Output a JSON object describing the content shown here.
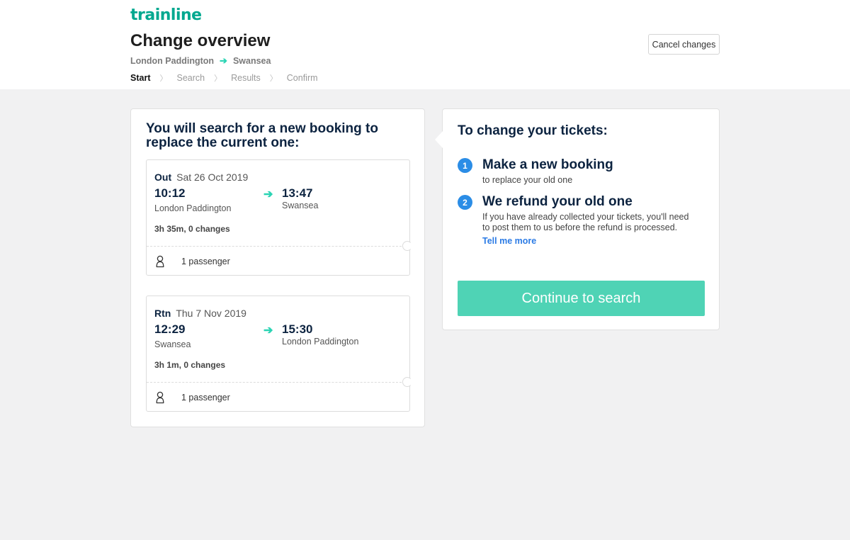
{
  "app": {
    "logo": "trainline"
  },
  "header": {
    "title": "Change overview",
    "route": {
      "from": "London Paddington",
      "to": "Swansea"
    },
    "steps": [
      "Start",
      "Search",
      "Results",
      "Confirm"
    ],
    "active_step": "Start",
    "cancel_label": "Cancel changes"
  },
  "left": {
    "heading": "You will search for a new booking to replace the current one:",
    "journeys": [
      {
        "direction": "Out",
        "date": "Sat 26 Oct 2019",
        "dep_time": "10:12",
        "arr_time": "13:47",
        "dep_station": "London Paddington",
        "arr_station": "Swansea",
        "duration": "3h 35m, 0 changes",
        "passengers": "1 passenger"
      },
      {
        "direction": "Rtn",
        "date": "Thu 7 Nov 2019",
        "dep_time": "12:29",
        "arr_time": "15:30",
        "dep_station": "Swansea",
        "arr_station": "London Paddington",
        "duration": "3h 1m, 0 changes",
        "passengers": "1 passenger"
      }
    ]
  },
  "right": {
    "heading": "To change your tickets:",
    "steps": [
      {
        "number": "1",
        "title": "Make a new booking",
        "text": "to replace your old one"
      },
      {
        "number": "2",
        "title": "We refund your old one",
        "text": "If you have already collected your tickets, you'll need to post them to us before the refund is processed."
      }
    ],
    "tell_more": "Tell me more",
    "continue_label": "Continue to search"
  },
  "colors": {
    "brand": "#00a88f",
    "accent_arrow": "#2bd4b4",
    "primary_button": "#4fd3b5",
    "step_badge": "#2b8de6",
    "link": "#2b7be5"
  },
  "icons": {
    "route_arrow": "arrow-right-icon",
    "step_separator": "chevron-right-icon",
    "journey_arrow": "arrow-right-icon",
    "passenger": "person-icon"
  }
}
